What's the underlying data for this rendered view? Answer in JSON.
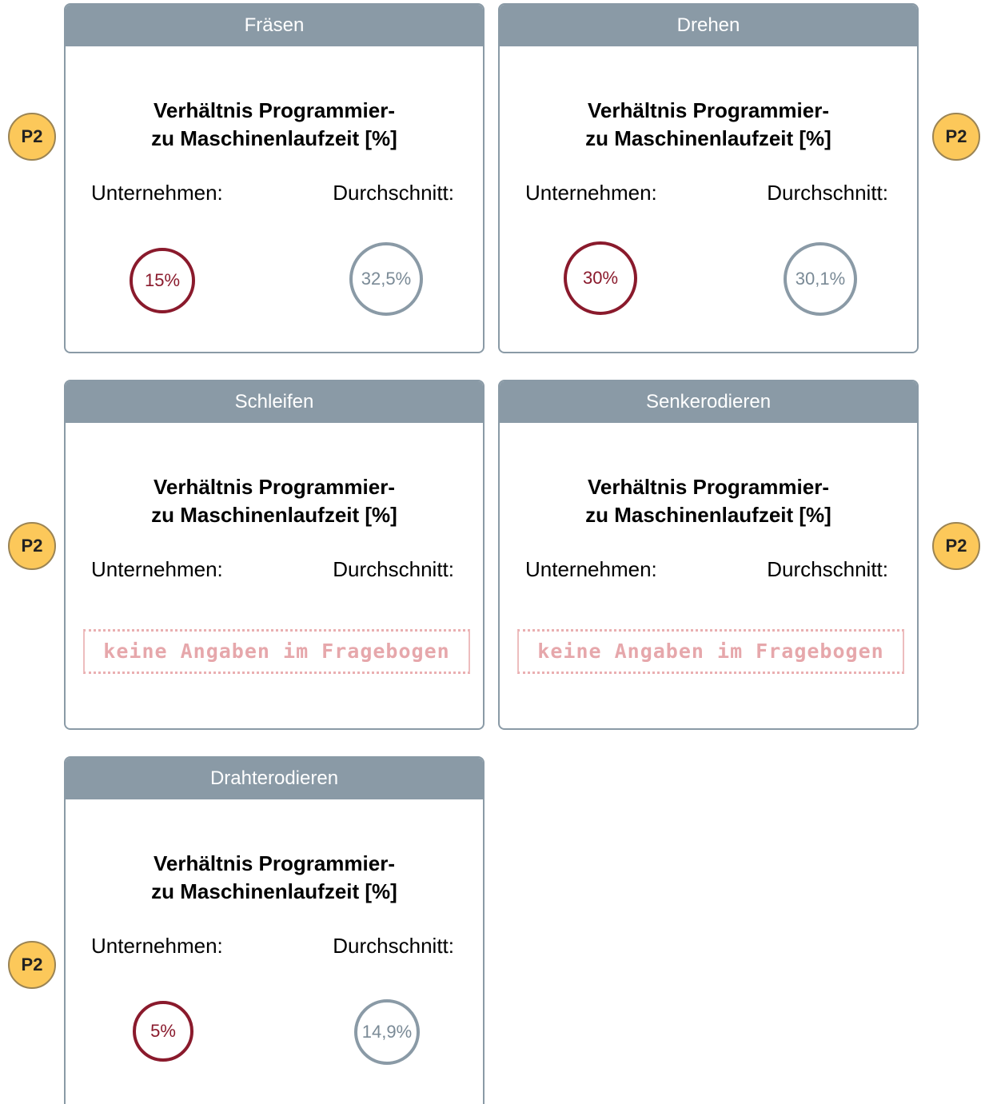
{
  "cards": [
    {
      "header": "Fräsen",
      "title_line1": "Verhältnis Programmier-",
      "title_line2": "zu Maschinenlaufzeit [%]",
      "company_label": "Unternehmen:",
      "average_label": "Durchschnitt:",
      "company_value": "15%",
      "average_value": "32,5%",
      "badge": "P2"
    },
    {
      "header": "Drehen",
      "title_line1": "Verhältnis Programmier-",
      "title_line2": "zu Maschinenlaufzeit [%]",
      "company_label": "Unternehmen:",
      "average_label": "Durchschnitt:",
      "company_value": "30%",
      "average_value": "30,1%",
      "badge": "P2"
    },
    {
      "header": "Schleifen",
      "title_line1": "Verhältnis Programmier-",
      "title_line2": "zu Maschinenlaufzeit [%]",
      "company_label": "Unternehmen:",
      "average_label": "Durchschnitt:",
      "stamp": "keine Angaben im Fragebogen",
      "badge": "P2"
    },
    {
      "header": "Senkerodieren",
      "title_line1": "Verhältnis Programmier-",
      "title_line2": "zu Maschinenlaufzeit [%]",
      "company_label": "Unternehmen:",
      "average_label": "Durchschnitt:",
      "stamp": "keine Angaben im Fragebogen",
      "badge": "P2"
    },
    {
      "header": "Drahterodieren",
      "title_line1": "Verhältnis Programmier-",
      "title_line2": "zu Maschinenlaufzeit [%]",
      "company_label": "Unternehmen:",
      "average_label": "Durchschnitt:",
      "company_value": "5%",
      "average_value": "14,9%",
      "badge": "P2"
    }
  ],
  "colors": {
    "header_bg": "#8a9aa6",
    "company": "#8a1a2c",
    "average": "#8a9aa6",
    "badge": "#fcc85a",
    "stamp": "#e49ea2"
  }
}
